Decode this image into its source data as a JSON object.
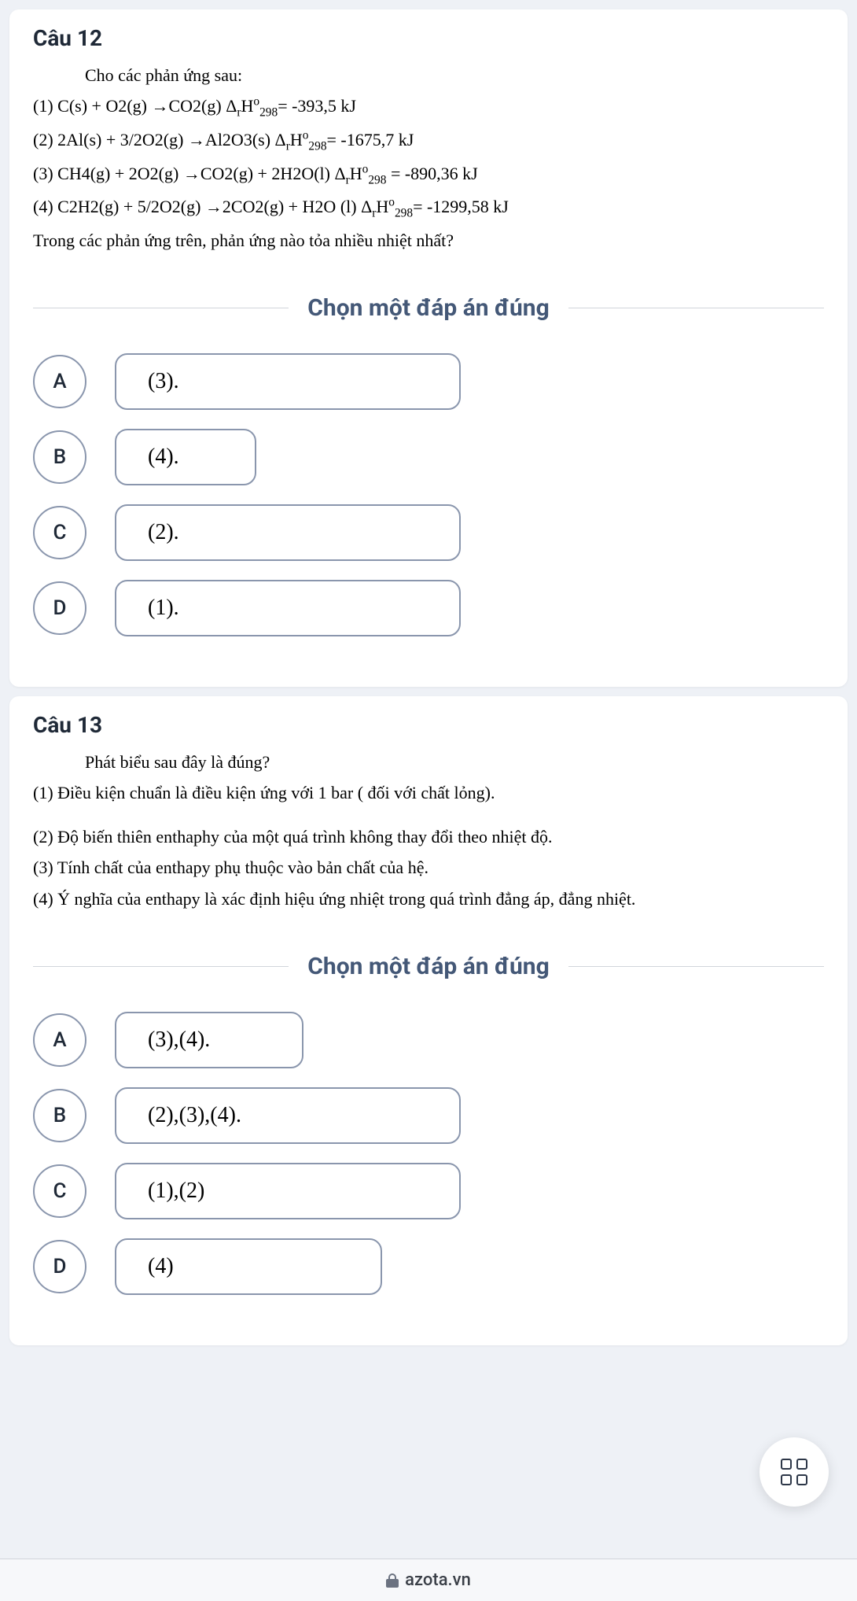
{
  "question12": {
    "header": "Câu 12",
    "intro": "Cho các phản ứng sau:",
    "line1_pre": "(1) C(s) + O2(g) →CO2(g)   Δ",
    "line1_sub": "r",
    "line1_mid": "H",
    "line1_sup": "o",
    "line1_midsub": "298",
    "line1_post": "= -393,5 kJ",
    "line2_pre": "(2) 2Al(s) + 3/2O2(g) →Al2O3(s)   Δ",
    "line2_post": "= -1675,7 kJ",
    "line3_pre": "(3) CH4(g) + 2O2(g) →CO2(g) + 2H2O(l)   Δ",
    "line3_post": " = -890,36 kJ",
    "line4_pre": "(4) C2H2(g) + 5/2O2(g) →2CO2(g) + H2O (l)   Δ",
    "line4_post": "= -1299,58 kJ",
    "closing": "Trong các phản ứng trên, phản ứng nào tỏa nhiều nhiệt nhất?",
    "section_title": "Chọn một đáp án đúng",
    "options": {
      "A": {
        "letter": "A",
        "text": "(3)."
      },
      "B": {
        "letter": "B",
        "text": "(4)."
      },
      "C": {
        "letter": "C",
        "text": "(2)."
      },
      "D": {
        "letter": "D",
        "text": "(1)."
      }
    }
  },
  "question13": {
    "header": "Câu 13",
    "intro": "Phát biểu sau đây là đúng?",
    "line1": "(1) Điều kiện chuẩn là điều kiện ứng với 1 bar ( đối với chất lỏng).",
    "line2": "(2) Độ biến thiên enthaphy của một quá trình không thay đổi theo nhiệt độ.",
    "line3": "(3) Tính chất của enthapy phụ thuộc vào bản chất của hệ.",
    "line4": "(4) Ý nghĩa của enthapy là xác định hiệu ứng nhiệt trong quá trình đẳng áp, đẳng nhiệt.",
    "section_title": "Chọn một đáp án đúng",
    "options": {
      "A": {
        "letter": "A",
        "text": "(3),(4)."
      },
      "B": {
        "letter": "B",
        "text": "(2),(3),(4)."
      },
      "C": {
        "letter": "C",
        "text": "(1),(2)"
      },
      "D": {
        "letter": "D",
        "text": "(4)"
      }
    }
  },
  "bottom_bar": {
    "domain": "azota.vn"
  }
}
